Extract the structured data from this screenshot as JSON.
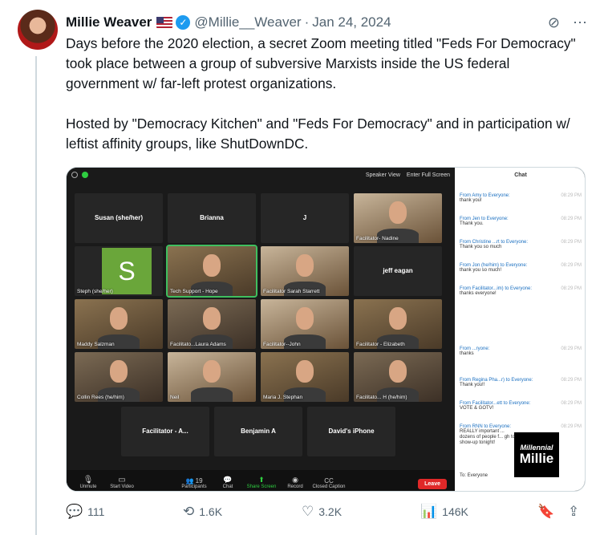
{
  "author": {
    "name": "Millie Weaver",
    "handle": "@Millie__Weaver",
    "sep": "·",
    "date": "Jan 24, 2024"
  },
  "tweet_text": "Days before the 2020 election, a secret Zoom meeting titled \"Feds For Democracy\" took place between a group of subversive Marxists inside the US federal government w/ far-left protest organizations.\n\nHosted by \"Democracy Kitchen\" and \"Feds For Democracy\" and in participation w/ leftist affinity groups, like ShutDownDC.",
  "zoom": {
    "top": {
      "speaker_view": "Speaker View",
      "full_screen": "Enter Full Screen"
    },
    "tiles": [
      {
        "name": "Susan (she/her)",
        "label": ""
      },
      {
        "name": "Brianna",
        "label": ""
      },
      {
        "name": "J",
        "label": ""
      },
      {
        "name": "",
        "label": "Facilitator- Nadine"
      },
      {
        "name": "",
        "label": "Steph (she/her)"
      },
      {
        "name": "",
        "label": "Tech Support - Hope"
      },
      {
        "name": "",
        "label": "Facilitator Sarah Starrett"
      },
      {
        "name": "jeff eagan",
        "label": ""
      },
      {
        "name": "",
        "label": "Maddy Salzman"
      },
      {
        "name": "",
        "label": "Facilitato...Laura Adams"
      },
      {
        "name": "",
        "label": "Facilitator--John"
      },
      {
        "name": "",
        "label": "Facilitator - Elizabeth"
      },
      {
        "name": "",
        "label": "Collin Rees (he/him)"
      },
      {
        "name": "",
        "label": "Neil"
      },
      {
        "name": "",
        "label": "Maria J. Stephan"
      },
      {
        "name": "",
        "label": "Facilitato... H (he/him)"
      },
      {
        "name": "Facilitator - A...",
        "label": ""
      },
      {
        "name": "Benjamin A",
        "label": ""
      },
      {
        "name": "David's iPhone",
        "label": ""
      }
    ],
    "s_letter": "S",
    "toolbar": {
      "unmute": "Unmute",
      "start_video": "Start Video",
      "participants": "Participants",
      "participants_count": "19",
      "chat": "Chat",
      "share": "Share Screen",
      "record": "Record",
      "caption": "Closed Caption",
      "leave": "Leave"
    }
  },
  "chat": {
    "title": "Chat",
    "messages": [
      {
        "from": "From Amy to Everyone:",
        "time": "08:29 PM",
        "text": "thank you!"
      },
      {
        "from": "From Jen to Everyone:",
        "time": "08:29 PM",
        "text": "Thank you."
      },
      {
        "from": "From Christine ...rt to Everyone:",
        "time": "08:29 PM",
        "text": "Thank you so much"
      },
      {
        "from": "From Jon (he/him) to Everyone:",
        "time": "08:29 PM",
        "text": "thank you so much!"
      },
      {
        "from": "From Facilitator...im) to Everyone:",
        "time": "08:29 PM",
        "text": "thanks everyone!"
      },
      {
        "from": "From ...ryone:",
        "time": "08:29 PM",
        "text": "thanks"
      },
      {
        "from": "From Regina Pha...r) to Everyone:",
        "time": "08:29 PM",
        "text": "Thank you!!"
      },
      {
        "from": "From Facilitator...ett to Everyone:",
        "time": "08:29 PM",
        "text": "VOTE & GOTV!"
      },
      {
        "from": "From RNN to Everyone:",
        "time": "08:29 PM",
        "text": "REALLY important ... dozens of people f... gh to show-up tonight!"
      }
    ],
    "to": "To: Everyone"
  },
  "logo": {
    "line1": "Millennial",
    "line2": "Millie"
  },
  "stats": {
    "replies": "111",
    "reposts": "1.6K",
    "likes": "3.2K",
    "views": "146K"
  },
  "icons": [
    "verified-icon",
    "flag-icon",
    "grok-icon",
    "more-icon",
    "reply-icon",
    "repost-icon",
    "like-icon",
    "views-icon",
    "bookmark-icon",
    "share-icon"
  ]
}
